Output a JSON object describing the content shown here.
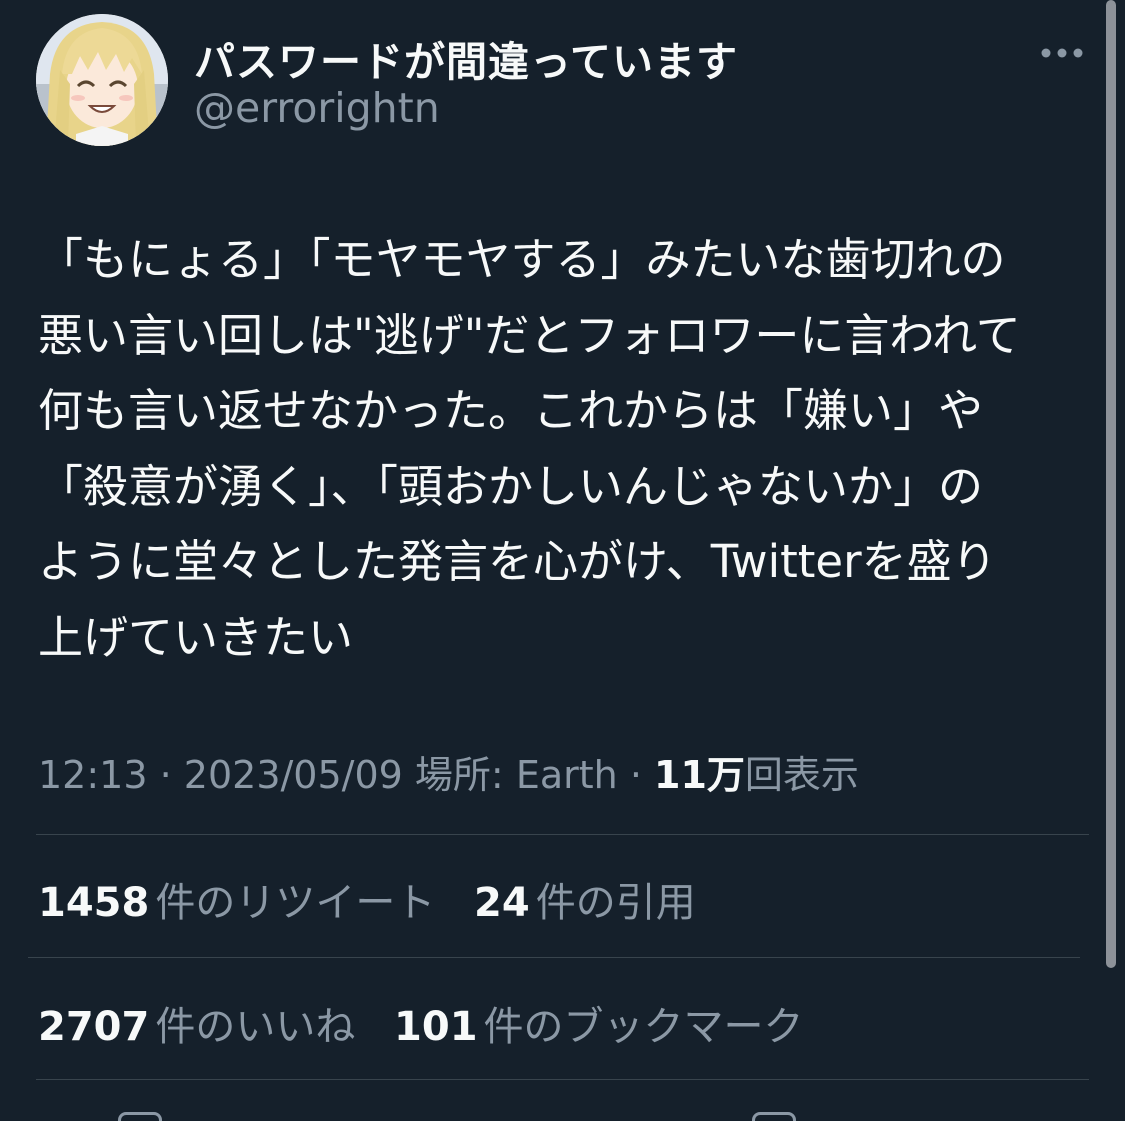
{
  "user": {
    "display_name": "パスワードが間違っています",
    "handle": "@errorightn",
    "avatar_icon": "anime-girl-avatar"
  },
  "tweet": {
    "lines": [
      "「もにょる」「モヤモヤする」みたいな歯切れの",
      "悪い言い回しは\"逃げ\"だとフォロワーに言われて",
      "何も言い返せなかった。これからは「嫌い」や",
      "「殺意が湧く」、「頭おかしいんじゃないか」の",
      "ように堂々とした発言を心がけ、Twitterを盛り",
      "上げていきたい"
    ]
  },
  "meta": {
    "time": "12:13",
    "date": "2023/05/09",
    "location_label": "場所:",
    "location": "Earth",
    "views_count": "11万",
    "views_label": "回表示",
    "separator": "·"
  },
  "stats": {
    "retweets": {
      "count": "1458",
      "label": "件のリツイート"
    },
    "quotes": {
      "count": "24",
      "label": "件の引用"
    },
    "likes": {
      "count": "2707",
      "label": "件のいいね"
    },
    "bookmarks": {
      "count": "101",
      "label": "件のブックマーク"
    }
  },
  "icons": {
    "more": "more-horizontal-icon"
  },
  "colors": {
    "background": "#15202b",
    "text": "#f7f9f9",
    "secondary": "#8b98a5",
    "divider": "#38444d"
  }
}
